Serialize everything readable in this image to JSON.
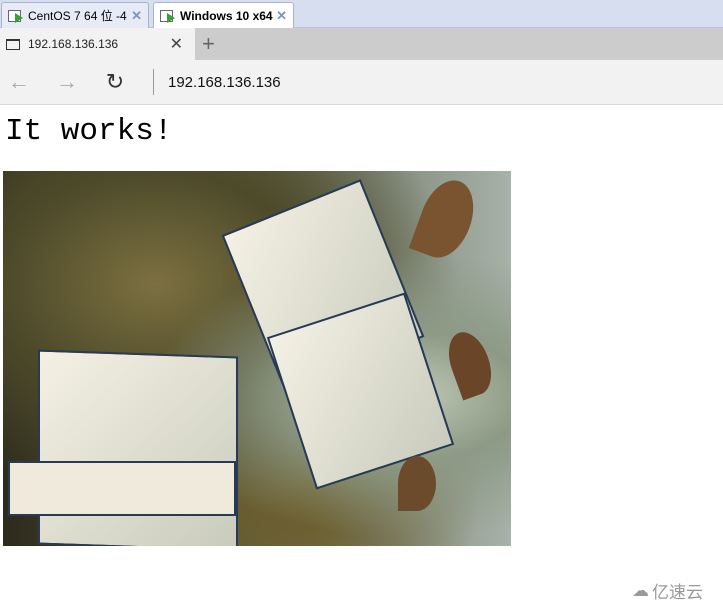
{
  "vm_tabs": [
    {
      "label": "CentOS 7 64 位 -4"
    },
    {
      "label": "Windows 10 x64"
    }
  ],
  "browser_tab": {
    "title": "192.168.136.136"
  },
  "address_bar": {
    "url": "192.168.136.136"
  },
  "page": {
    "heading": "It works!"
  },
  "watermark": {
    "text": "亿速云"
  }
}
